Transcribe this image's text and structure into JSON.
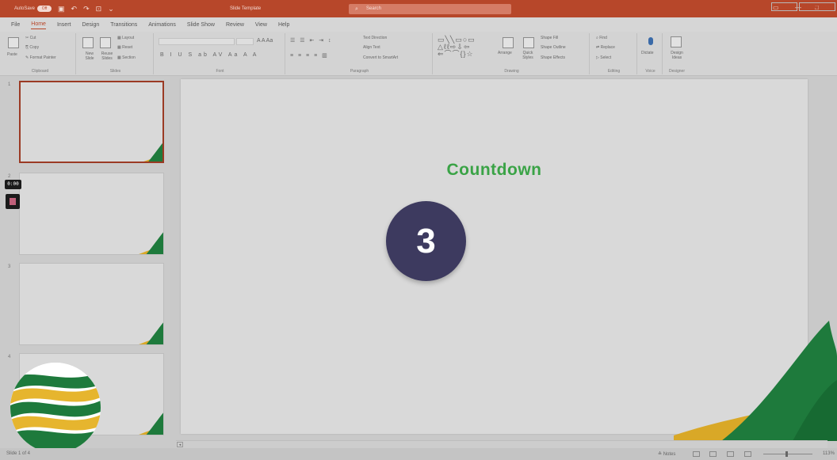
{
  "titlebar": {
    "autosave_label": "AutoSave",
    "autosave_state": "Off",
    "doc_title": "Slide Template",
    "search_placeholder": "Search"
  },
  "tabs": [
    "File",
    "Home",
    "Insert",
    "Design",
    "Transitions",
    "Animations",
    "Slide Show",
    "Review",
    "View",
    "Help"
  ],
  "active_tab": "Home",
  "share_label": "Share",
  "comments_label": "Comments",
  "ribbon": {
    "clipboard": {
      "paste": "Paste",
      "cut": "Cut",
      "copy": "Copy",
      "format_painter": "Format Painter",
      "label": "Clipboard"
    },
    "slides": {
      "new_slide": "New Slide",
      "reuse_slides": "Reuse Slides",
      "layout": "Layout",
      "reset": "Reset",
      "section": "Section",
      "label": "Slides"
    },
    "font": {
      "label": "Font"
    },
    "paragraph": {
      "text_direction": "Text Direction",
      "align_text": "Align Text",
      "convert_smartart": "Convert to SmartArt",
      "label": "Paragraph"
    },
    "drawing": {
      "arrange": "Arrange",
      "quick_styles": "Quick Styles",
      "shape_fill": "Shape Fill",
      "shape_outline": "Shape Outline",
      "shape_effects": "Shape Effects",
      "label": "Drawing"
    },
    "editing": {
      "find": "Find",
      "replace": "Replace",
      "select": "Select",
      "label": "Editing"
    },
    "voice": {
      "dictate": "Dictate",
      "label": "Voice"
    },
    "designer": {
      "design_ideas": "Design Ideas",
      "label": "Designer"
    }
  },
  "thumbnails": [
    {
      "num": "1",
      "selected": true
    },
    {
      "num": "2",
      "selected": false
    },
    {
      "num": "3",
      "selected": false
    },
    {
      "num": "4",
      "selected": false
    }
  ],
  "timer": "0:00",
  "slide": {
    "title": "Countdown",
    "count": "3"
  },
  "status": {
    "slide_info": "Slide 1 of 4",
    "notes": "Notes",
    "zoom": "113%"
  },
  "colors": {
    "accent": "#b7472a",
    "title_green": "#3aa346",
    "circle": "#3d3a5f",
    "deco_green": "#1e7a3c",
    "deco_yellow": "#d9a827"
  }
}
